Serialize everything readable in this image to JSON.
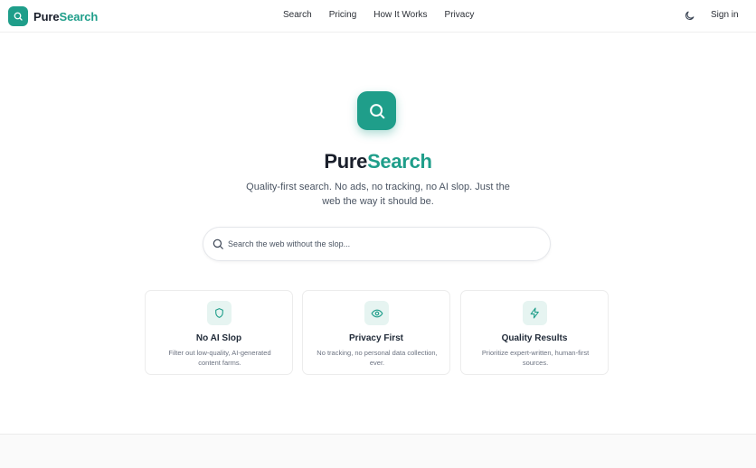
{
  "brand": {
    "name_part1": "Pure",
    "name_part2": "Search",
    "accent": "#1f9e8a"
  },
  "nav": {
    "items": [
      {
        "label": "Search"
      },
      {
        "label": "Pricing"
      },
      {
        "label": "How It Works"
      },
      {
        "label": "Privacy"
      }
    ],
    "theme_icon": "moon-icon",
    "signin_label": "Sign in"
  },
  "hero": {
    "icon": "search-icon",
    "title_part1": "Pure",
    "title_part2": "Search",
    "subtitle": "Quality-first search. No ads, no tracking, no AI slop. Just the web the way it should be."
  },
  "search": {
    "placeholder": "Search the web without the slop...",
    "value": ""
  },
  "features": [
    {
      "icon": "shield-icon",
      "title": "No AI Slop",
      "description": "Filter out low-quality, AI-generated content farms."
    },
    {
      "icon": "eye-icon",
      "title": "Privacy First",
      "description": "No tracking, no personal data collection, ever."
    },
    {
      "icon": "zap-icon",
      "title": "Quality Results",
      "description": "Prioritize expert-written, human-first sources."
    }
  ]
}
